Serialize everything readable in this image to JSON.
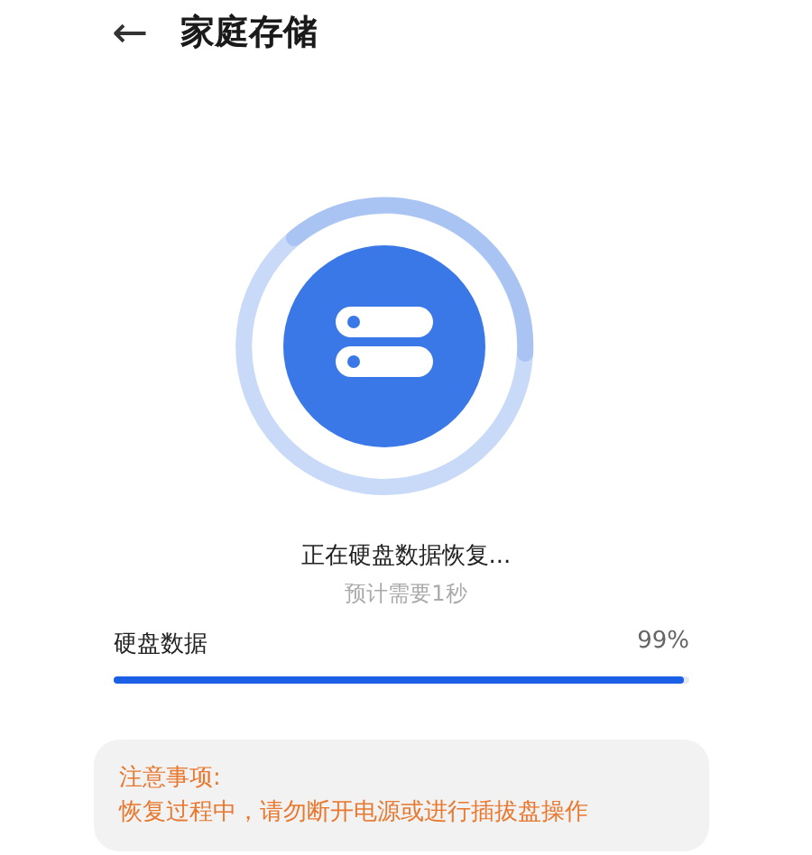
{
  "header": {
    "back": "←",
    "title": "家庭存储"
  },
  "status": {
    "message": "正在硬盘数据恢复...",
    "estimate": "预计需要1秒"
  },
  "progress": {
    "label": "硬盘数据",
    "reading": "99%",
    "level": 0.99
  },
  "notice": {
    "title": "注意事项:",
    "text": "恢复过程中，请勿断开电源或进行插拔盘操作"
  }
}
